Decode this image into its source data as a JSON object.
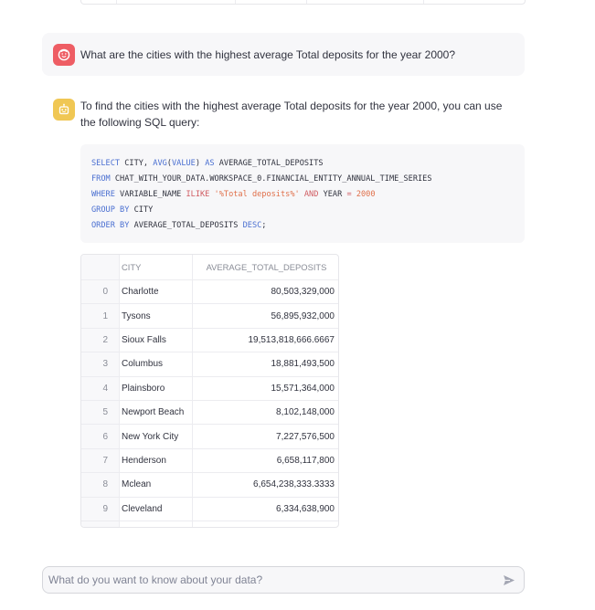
{
  "conversation": {
    "user_message": "What are the cities with the highest average Total deposits for the year 2000?",
    "assistant_message": "To find the cities with the highest average Total deposits for the year 2000, you can use the following SQL query:",
    "sql_lines": [
      "SELECT CITY, AVG(VALUE) AS AVERAGE_TOTAL_DEPOSITS",
      "FROM CHAT_WITH_YOUR_DATA.WORKSPACE_0.FINANCIAL_ENTITY_ANNUAL_TIME_SERIES",
      "WHERE VARIABLE_NAME ILIKE '%Total deposits%' AND YEAR = 2000",
      "GROUP BY CITY",
      "ORDER BY AVERAGE_TOTAL_DEPOSITS DESC;"
    ],
    "results_table": {
      "columns": [
        "CITY",
        "AVERAGE_TOTAL_DEPOSITS"
      ],
      "rows": [
        {
          "index": "0",
          "city": "Charlotte",
          "avg": "80,503,329,000"
        },
        {
          "index": "1",
          "city": "Tysons",
          "avg": "56,895,932,000"
        },
        {
          "index": "2",
          "city": "Sioux Falls",
          "avg": "19,513,818,666.6667"
        },
        {
          "index": "3",
          "city": "Columbus",
          "avg": "18,881,493,500"
        },
        {
          "index": "4",
          "city": "Plainsboro",
          "avg": "15,571,364,000"
        },
        {
          "index": "5",
          "city": "Newport Beach",
          "avg": "8,102,148,000"
        },
        {
          "index": "6",
          "city": "New York City",
          "avg": "7,227,576,500"
        },
        {
          "index": "7",
          "city": "Henderson",
          "avg": "6,658,117,800"
        },
        {
          "index": "8",
          "city": "Mclean",
          "avg": "6,654,238,333.3333"
        },
        {
          "index": "9",
          "city": "Cleveland",
          "avg": "6,334,638,900"
        }
      ]
    }
  },
  "chat_input": {
    "placeholder": "What do you want to know about your data?",
    "value": ""
  },
  "icons": {
    "user_avatar": "user-face-icon",
    "assistant_avatar": "robot-icon",
    "send": "send-icon"
  },
  "colors": {
    "user_avatar_bg": "#ee5d64",
    "assistant_avatar_bg": "#f0c754",
    "sql_keyword": "#4a6fd1",
    "sql_string": "#e0704b"
  }
}
